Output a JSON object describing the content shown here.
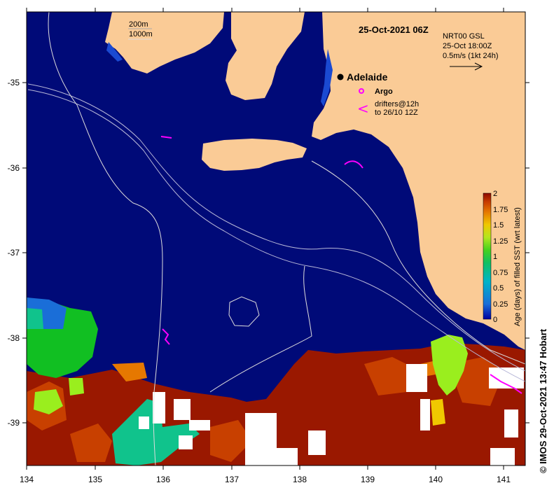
{
  "map": {
    "title": "25-Oct-2021 06Z",
    "current_info": {
      "line1": "NRT00 GSL",
      "line2": "25-Oct 18:00Z",
      "line3": "0.5m/s (1kt 24h)"
    },
    "depth_legend": {
      "line1": "200m",
      "line2": "1000m"
    },
    "city": "Adelaide",
    "legend": {
      "argo": "Argo",
      "drifters_line1": "drifters@12h",
      "drifters_line2": "to 26/10 12Z"
    },
    "credit": "© IMOS 29-Oct-2021 13:47 Hobart",
    "x_ticks": [
      "134",
      "135",
      "136",
      "137",
      "138",
      "139",
      "140",
      "141"
    ],
    "y_ticks": [
      "-35",
      "-36",
      "-37",
      "-38",
      "-39"
    ],
    "colorbar": {
      "label": "Age (days) of filled SST (wrt latest)",
      "ticks": [
        "0",
        "0.25",
        "0.5",
        "0.75",
        "1",
        "1.25",
        "1.5",
        "1.75",
        "2"
      ],
      "colors": [
        "#0000a0",
        "#1a6ed8",
        "#00b4c8",
        "#10c060",
        "#46d21e",
        "#b4e61e",
        "#f0c800",
        "#e67800",
        "#c83c00",
        "#8c0a00"
      ]
    },
    "colors": {
      "ocean": "#000a78",
      "land": "#facb96",
      "old": "#9a1800",
      "mid": "#c84000",
      "young": "#11bf22",
      "lime": "#9aee1e",
      "cyan": "#10c38c",
      "magenta": "#ff00ff"
    }
  }
}
